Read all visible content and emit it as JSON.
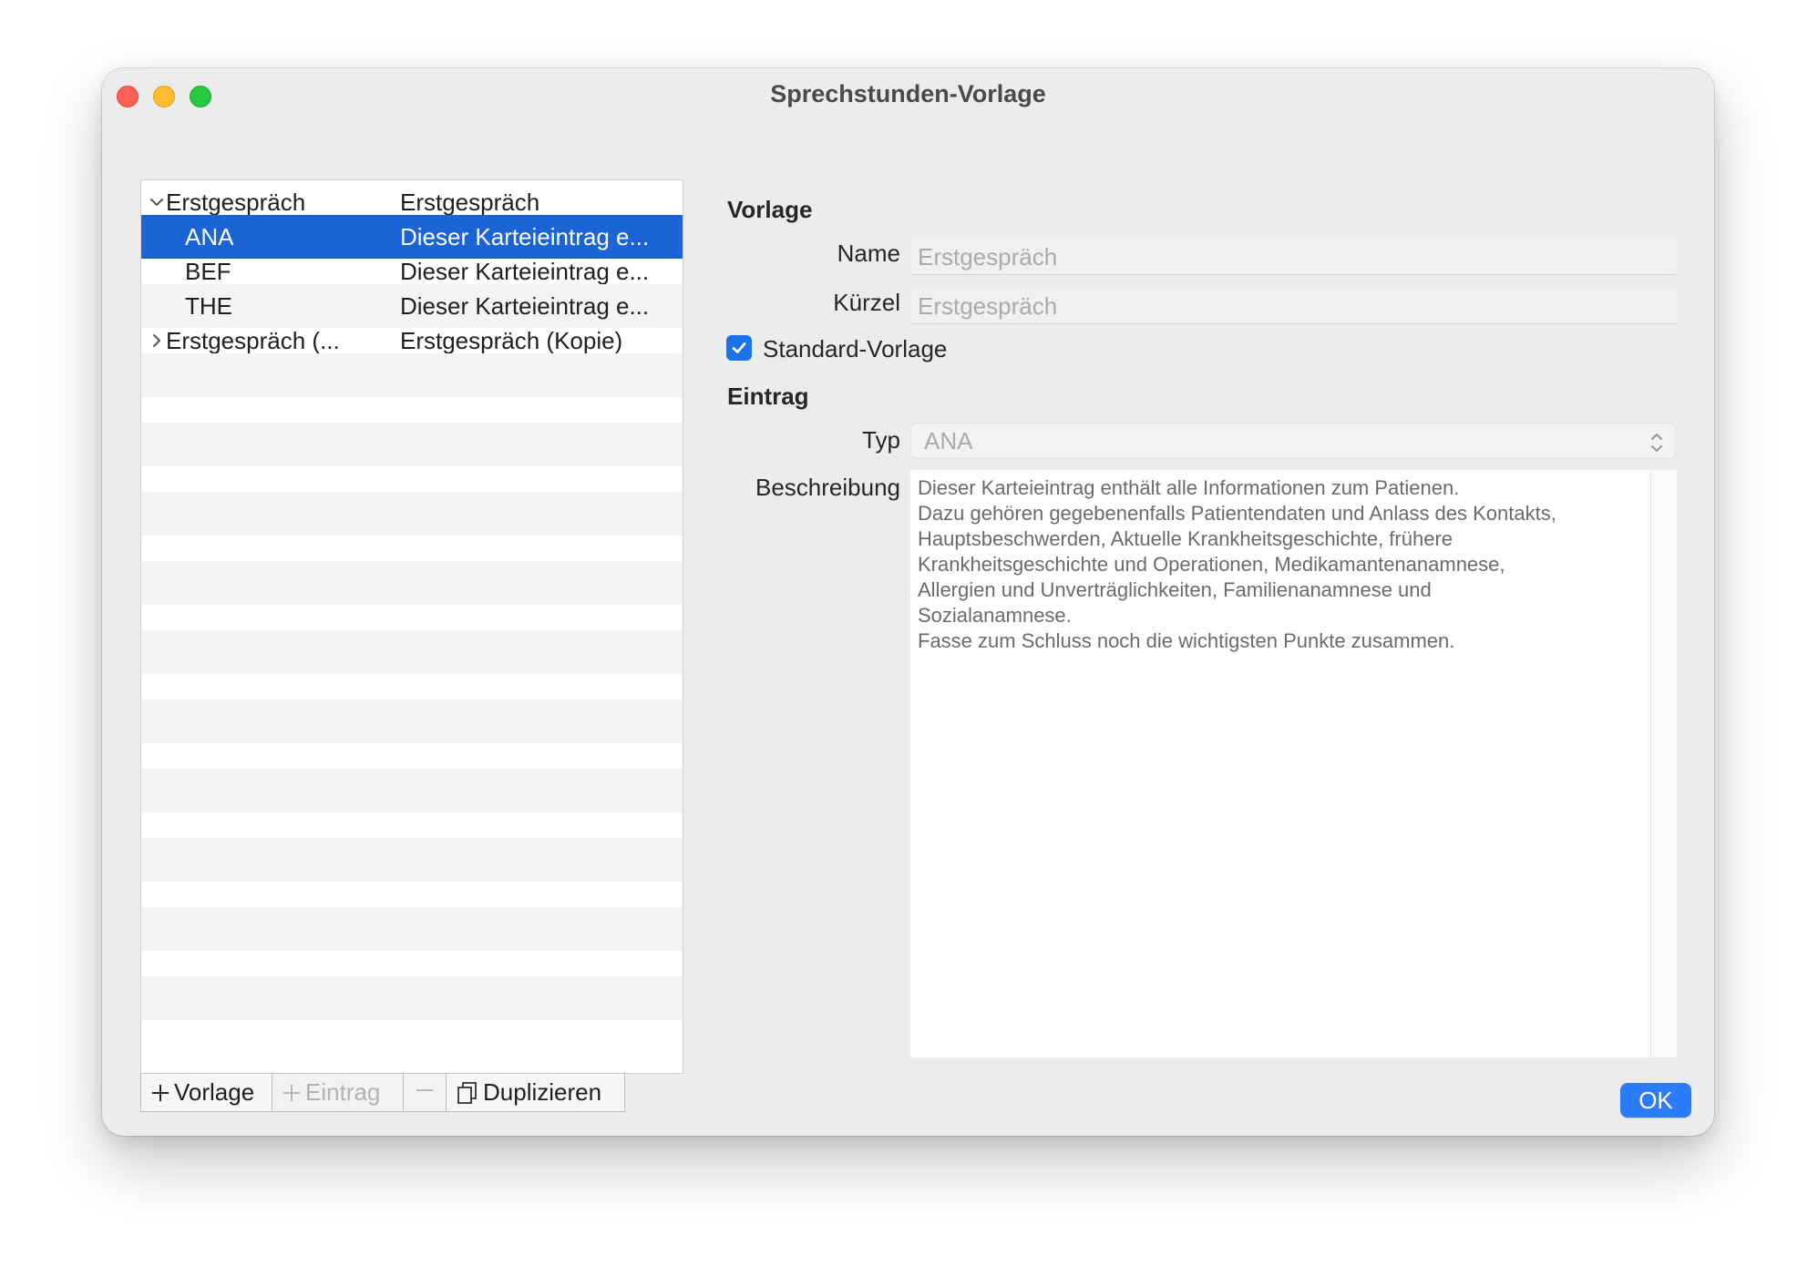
{
  "window": {
    "title": "Sprechstunden-Vorlage"
  },
  "list": {
    "rows": [
      {
        "col1": "Erstgespräch",
        "col2": "Erstgespräch",
        "expanded": true
      },
      {
        "col1": "ANA",
        "col2": "Dieser Karteieintrag e...",
        "selected": true
      },
      {
        "col1": "BEF",
        "col2": "Dieser Karteieintrag e..."
      },
      {
        "col1": "THE",
        "col2": "Dieser Karteieintrag e..."
      },
      {
        "col1": "Erstgespräch (...",
        "col2": "Erstgespräch (Kopie)",
        "expanded": false
      }
    ]
  },
  "toolbar": {
    "add_vorlage_label": "Vorlage",
    "add_eintrag_label": "Eintrag",
    "duplicate_label": "Duplizieren"
  },
  "form": {
    "section_vorlage": "Vorlage",
    "name_label": "Name",
    "name_value": "Erstgespräch",
    "kuerzel_label": "Kürzel",
    "kuerzel_value": "Erstgespräch",
    "standard_label": "Standard-Vorlage",
    "standard_checked": true,
    "section_eintrag": "Eintrag",
    "typ_label": "Typ",
    "typ_value": "ANA",
    "beschreibung_label": "Beschreibung",
    "beschreibung_value": "Dieser Karteieintrag enthält alle Informationen zum Patienen.\nDazu gehören gegebenenfalls Patientendaten und Anlass des Kontakts,\nHauptsbeschwerden, Aktuelle Krankheitsgeschichte, frühere\nKrankheitsgeschichte und Operationen, Medikamantenanamnese,\nAllergien und Unverträglichkeiten, Familienanamnese und\nSozialanamnese.\nFasse zum Schluss noch die wichtigsten Punkte zusammen."
  },
  "ok_label": "OK",
  "colors": {
    "selection": "#1a64d6",
    "accent": "#2b7cf6",
    "window_bg": "#ececec"
  }
}
